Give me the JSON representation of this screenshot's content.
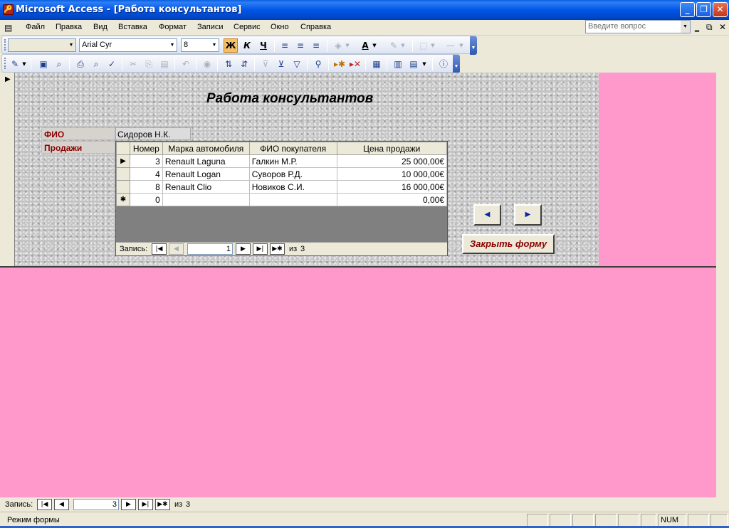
{
  "window": {
    "title": "Microsoft Access - [Работа  консультантов]",
    "minimize": "_",
    "restore": "❐",
    "close": "✕"
  },
  "menu": {
    "items": [
      "Файл",
      "Правка",
      "Вид",
      "Вставка",
      "Формат",
      "Записи",
      "Сервис",
      "Окно",
      "Справка"
    ],
    "ask_placeholder": "Введите вопрос"
  },
  "formatting_toolbar": {
    "object_combo": "",
    "font_name": "Arial Cyr",
    "font_size": "8",
    "bold": "Ж",
    "italic": "К",
    "underline": "Ч"
  },
  "form": {
    "title": "Работа консультантов",
    "fio_label": "ФИО",
    "fio_value": "Сидоров Н.К.",
    "sales_label": "Продажи",
    "subform": {
      "columns": [
        "Номер",
        "Марка автомобиля",
        "ФИО покупателя",
        "Цена продажи"
      ],
      "rows": [
        {
          "selector": "▶",
          "number": "3",
          "car": "Renault Laguna",
          "buyer": "Галкин М.Р.",
          "price": "25 000,00€"
        },
        {
          "selector": "",
          "number": "4",
          "car": "Renault Logan",
          "buyer": "Суворов Р.Д.",
          "price": "10 000,00€"
        },
        {
          "selector": "",
          "number": "8",
          "car": "Renault Clio",
          "buyer": "Новиков С.И.",
          "price": "16 000,00€"
        },
        {
          "selector": "✱",
          "number": "0",
          "car": "",
          "buyer": "",
          "price": "0,00€"
        }
      ],
      "nav": {
        "record_label": "Запись:",
        "current": "1",
        "of_label": "из",
        "total": "3"
      }
    },
    "prev_button": "◀",
    "next_button": "▶",
    "close_button": "Закрыть форму"
  },
  "main_nav": {
    "record_label": "Запись:",
    "current": "3",
    "of_label": "из",
    "total": "3"
  },
  "status": {
    "mode": "Режим формы",
    "num": "NUM"
  },
  "colors": {
    "workspace_bg": "#ff99cc",
    "label_text": "#8b0000",
    "titlebar": "#0055e5"
  }
}
